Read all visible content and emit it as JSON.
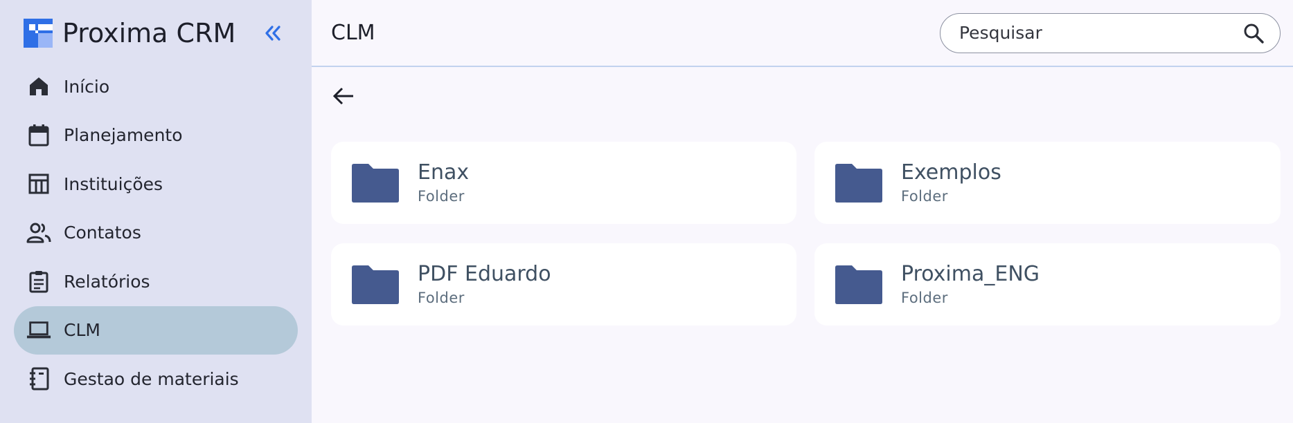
{
  "app": {
    "name": "Proxima CRM",
    "brand_color": "#2f6fe6"
  },
  "sidebar": {
    "items": [
      {
        "label": "Início",
        "icon": "home-icon",
        "active": false
      },
      {
        "label": "Planejamento",
        "icon": "calendar-icon",
        "active": false
      },
      {
        "label": "Instituições",
        "icon": "institution-icon",
        "active": false
      },
      {
        "label": "Contatos",
        "icon": "contacts-icon",
        "active": false
      },
      {
        "label": "Relatórios",
        "icon": "clipboard-icon",
        "active": false
      },
      {
        "label": "CLM",
        "icon": "laptop-icon",
        "active": true
      },
      {
        "label": "Gestao de materiais",
        "icon": "notebook-icon",
        "active": false
      }
    ]
  },
  "header": {
    "title": "CLM",
    "search_placeholder": "Pesquisar"
  },
  "folders": [
    {
      "name": "Enax",
      "type": "Folder"
    },
    {
      "name": "Exemplos",
      "type": "Folder"
    },
    {
      "name": "PDF Eduardo",
      "type": "Folder"
    },
    {
      "name": "Proxima_ENG",
      "type": "Folder"
    }
  ],
  "colors": {
    "sidebar_bg": "#dfe1f2",
    "active_item_bg": "#b4c9d9",
    "folder_icon": "#455a8f",
    "page_bg": "#f9f7fd"
  }
}
